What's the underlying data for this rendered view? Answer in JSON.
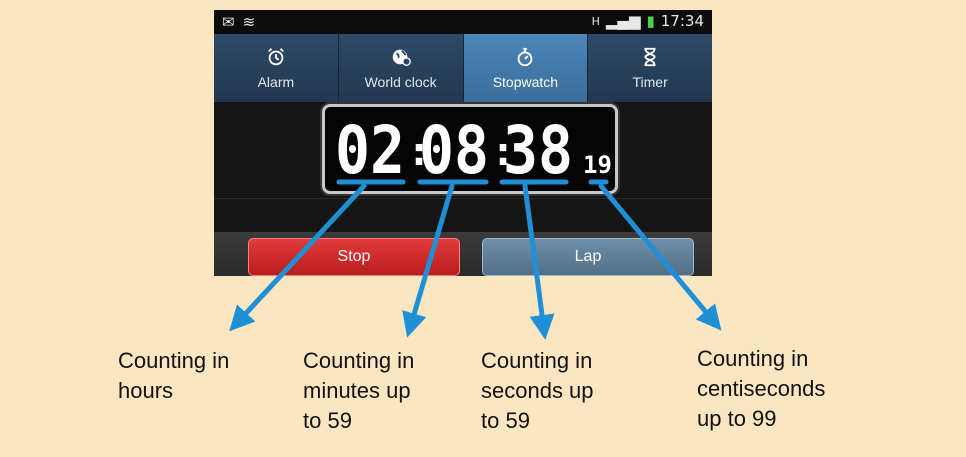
{
  "status_bar": {
    "time": "17:34"
  },
  "tabs": [
    {
      "label": "Alarm",
      "icon": "alarm-clock-icon"
    },
    {
      "label": "World clock",
      "icon": "globe-icon"
    },
    {
      "label": "Stopwatch",
      "icon": "stopwatch-icon",
      "active": true
    },
    {
      "label": "Timer",
      "icon": "hourglass-icon"
    }
  ],
  "stopwatch": {
    "hours": "02",
    "minutes": "08",
    "seconds": "38",
    "centiseconds": "19",
    "separator": ":"
  },
  "buttons": {
    "stop": "Stop",
    "lap": "Lap"
  },
  "captions": {
    "hours": "Counting in\nhours",
    "minutes": "Counting in\nminutes up\nto 59",
    "seconds": "Counting in\nseconds up\nto 59",
    "centiseconds": "Counting in\ncentiseconds\nup to 99"
  },
  "colors": {
    "arrow": "#1f8fd6",
    "stop": "#d32a2a",
    "lap": "#5f7f97",
    "active_tab": "#4276a4",
    "background": "#fbe6c2"
  }
}
